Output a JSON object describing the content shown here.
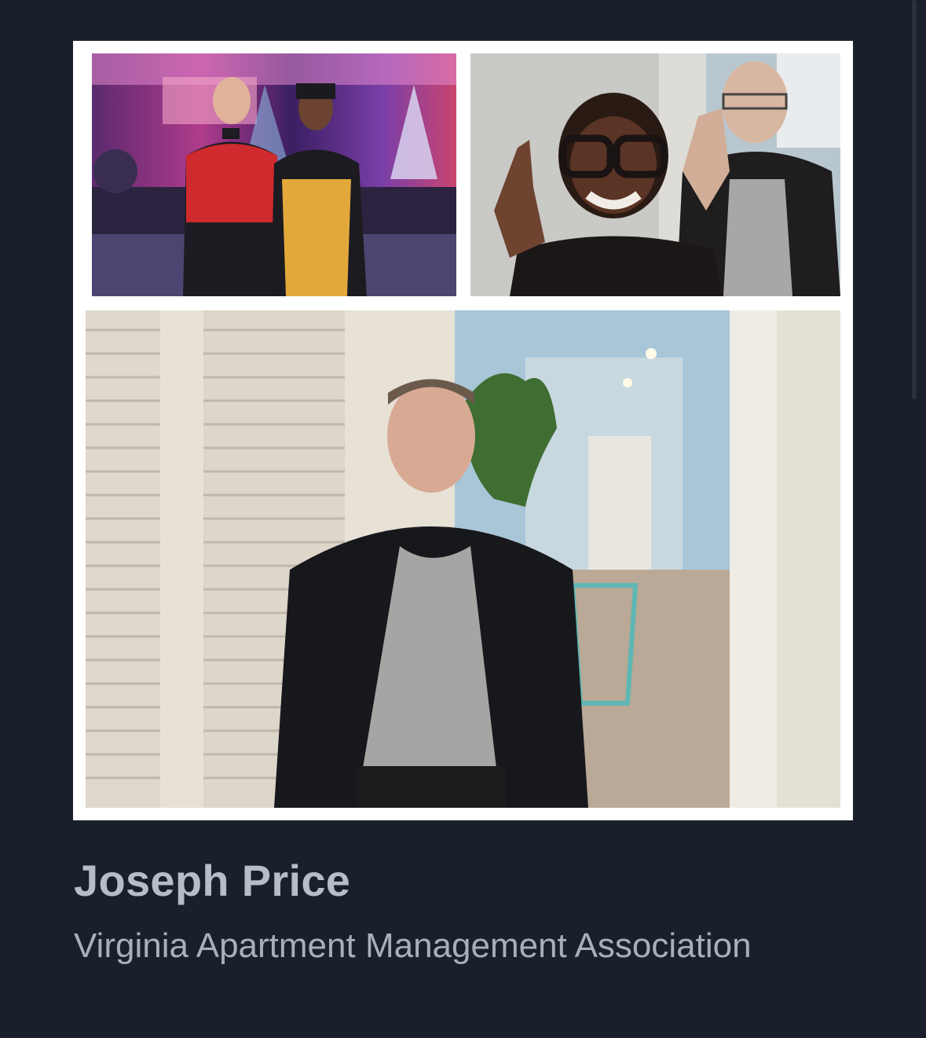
{
  "profile": {
    "name": "Joseph Price",
    "organization": "Virginia Apartment Management Association"
  },
  "photos": [
    {
      "name": "party-photo"
    },
    {
      "name": "selfie-photo"
    },
    {
      "name": "portrait-photo"
    }
  ],
  "colors": {
    "background": "#1a202b",
    "name_text": "#b6bcc8",
    "organization_text": "#a9afba",
    "collage_border": "#ffffff"
  }
}
